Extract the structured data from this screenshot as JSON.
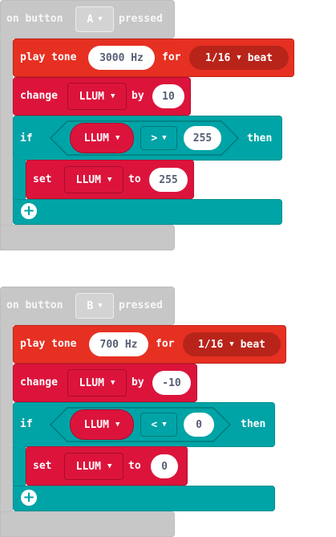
{
  "block_a": {
    "event": {
      "prefix": "on button",
      "button": "A",
      "suffix": "pressed"
    },
    "play": {
      "label": "play tone",
      "freq": "3000 Hz",
      "for": "for",
      "beat": "1/16",
      "beat_word": "beat"
    },
    "change": {
      "label": "change",
      "var": "LLUM",
      "by": "by",
      "value": "10"
    },
    "if": {
      "label": "if",
      "var": "LLUM",
      "op": ">",
      "value": "255",
      "then": "then"
    },
    "set": {
      "label": "set",
      "var": "LLUM",
      "to": "to",
      "value": "255"
    }
  },
  "block_b": {
    "event": {
      "prefix": "on button",
      "button": "B",
      "suffix": "pressed"
    },
    "play": {
      "label": "play tone",
      "freq": "700 Hz",
      "for": "for",
      "beat": "1/16",
      "beat_word": "beat"
    },
    "change": {
      "label": "change",
      "var": "LLUM",
      "by": "by",
      "value": "-10"
    },
    "if": {
      "label": "if",
      "var": "LLUM",
      "op": "<",
      "value": "0",
      "then": "then"
    },
    "set": {
      "label": "set",
      "var": "LLUM",
      "to": "to",
      "value": "0"
    }
  },
  "colors": {
    "event": "#c7c7c7",
    "music": "#e63022",
    "variables": "#dc143c",
    "logic": "#00a4a6"
  },
  "icons": {
    "caret": "triangle-down",
    "add": "plus-circle"
  }
}
